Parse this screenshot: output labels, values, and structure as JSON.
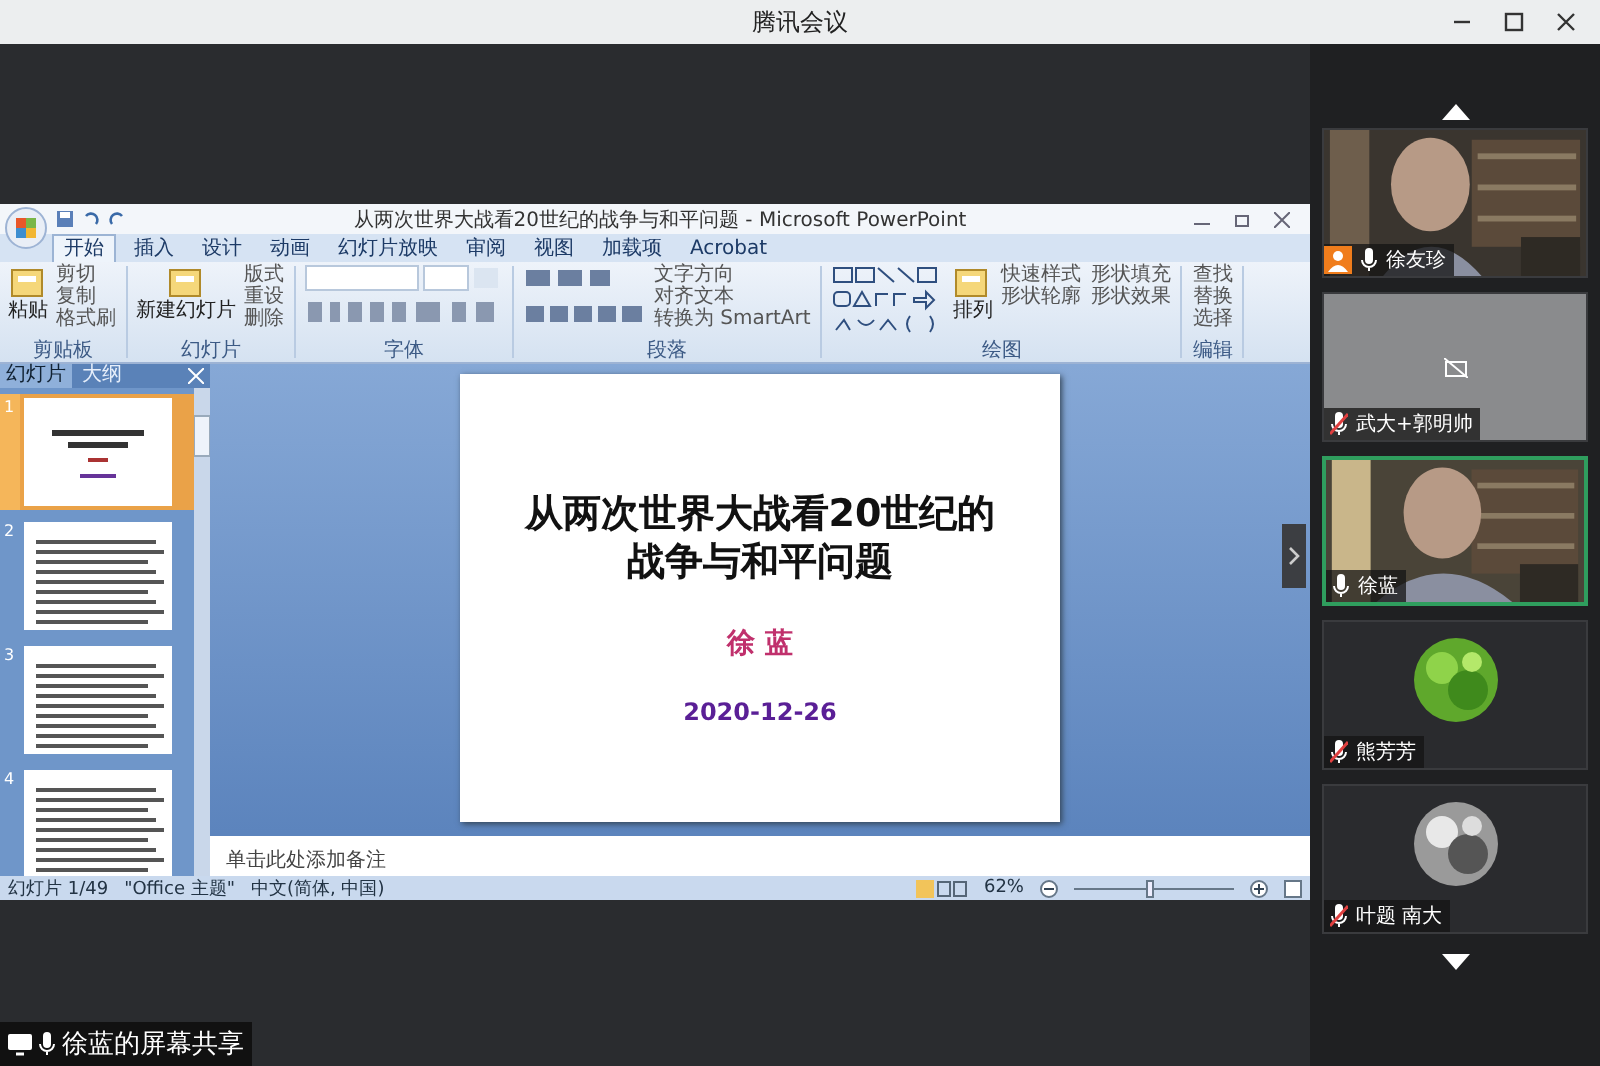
{
  "app": {
    "title": "腾讯会议"
  },
  "ppt": {
    "title": "从两次世界大战看20世纪的战争与和平问题 - Microsoft PowerPoint",
    "ribbon_tabs": [
      {
        "label": "开始",
        "selected": true
      },
      {
        "label": "插入",
        "selected": false
      },
      {
        "label": "设计",
        "selected": false
      },
      {
        "label": "动画",
        "selected": false
      },
      {
        "label": "幻灯片放映",
        "selected": false
      },
      {
        "label": "审阅",
        "selected": false
      },
      {
        "label": "视图",
        "selected": false
      },
      {
        "label": "加载项",
        "selected": false
      },
      {
        "label": "Acrobat",
        "selected": false
      }
    ],
    "groups": [
      {
        "label": "剪贴板",
        "big": "粘贴",
        "buttons": [
          "剪切",
          "复制",
          "格式刷"
        ]
      },
      {
        "label": "幻灯片",
        "big": "新建幻灯片",
        "buttons": [
          "版式",
          "重设",
          "删除"
        ]
      },
      {
        "label": "字体"
      },
      {
        "label": "段落",
        "buttons": [
          "文字方向",
          "对齐文本",
          "转换为 SmartArt"
        ]
      },
      {
        "label": "绘图",
        "big": "排列",
        "buttons": [
          "快速样式",
          "形状填充",
          "形状轮廓",
          "形状效果"
        ]
      },
      {
        "label": "编辑",
        "buttons": [
          "查找",
          "替换",
          "选择"
        ]
      }
    ],
    "panel_tabs": [
      {
        "label": "幻灯片",
        "selected": true
      },
      {
        "label": "大纲",
        "selected": false
      }
    ],
    "thumbnails": [
      {
        "number": "1",
        "selected": true
      },
      {
        "number": "2",
        "selected": false
      },
      {
        "number": "3",
        "selected": false
      },
      {
        "number": "4",
        "selected": false
      }
    ],
    "slide": {
      "title_lines": [
        "从两次世界大战看20世纪的",
        "战争与和平问题"
      ],
      "author": "徐 蓝",
      "date": "2020-12-26"
    },
    "notes_placeholder": "单击此处添加备注",
    "status": [
      "幻灯片 1/49",
      "\"Office 主题\"",
      "中文(简体, 中国)"
    ],
    "zoom": {
      "reading": "62%",
      "level": 0.45
    }
  },
  "share_label": "徐蓝的屏幕共享",
  "participants": [
    {
      "name": "徐友珍",
      "kind": "video",
      "host": true,
      "muted": false,
      "speaking": false
    },
    {
      "name": "武大+郭明帅",
      "kind": "camera_off",
      "host": false,
      "muted": true,
      "speaking": false
    },
    {
      "name": "徐蓝",
      "kind": "video",
      "host": false,
      "muted": false,
      "speaking": true
    },
    {
      "name": "熊芳芳",
      "kind": "avatar",
      "host": false,
      "muted": true,
      "speaking": false
    },
    {
      "name": "叶题 南大",
      "kind": "avatar",
      "host": false,
      "muted": true,
      "speaking": false
    }
  ]
}
